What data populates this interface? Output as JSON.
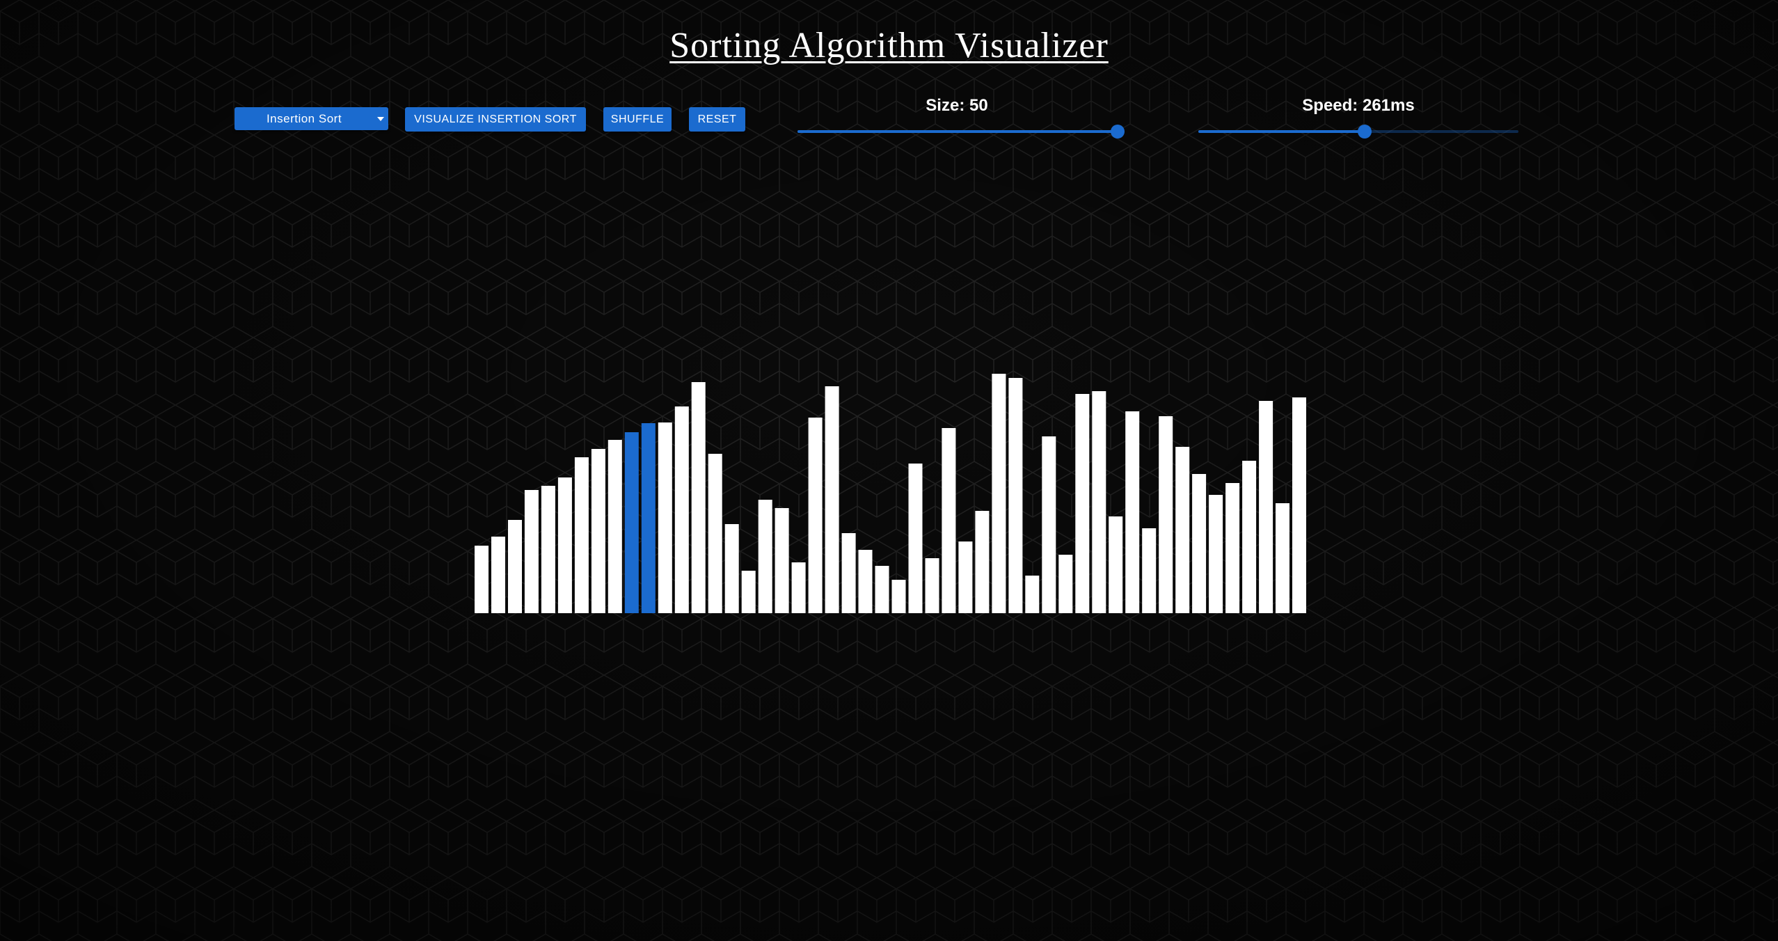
{
  "app": {
    "title": "Sorting Algorithm Visualizer"
  },
  "controls": {
    "algorithm_select": {
      "selected": "Insertion Sort"
    },
    "visualize_label": "VISUALIZE INSERTION SORT",
    "shuffle_label": "SHUFFLE",
    "reset_label": "RESET",
    "size_slider": {
      "label": "Size: 50",
      "value": 50,
      "fraction": 1.0
    },
    "speed_slider": {
      "label": "Speed: 261ms",
      "value_ms": 261,
      "fraction": 0.52
    }
  },
  "colors": {
    "accent": "#1b6bcf",
    "bar": "#ffffff",
    "active_bar": "#1b6bcf",
    "background": "#0a0a0a"
  },
  "array": {
    "values": [
      97,
      110,
      134,
      177,
      183,
      195,
      224,
      236,
      249,
      260,
      273,
      274,
      297,
      332,
      229,
      128,
      61,
      163,
      151,
      73,
      281,
      326,
      115,
      91,
      68,
      48,
      215,
      79,
      266,
      103,
      147,
      344,
      338,
      54,
      254,
      84,
      315,
      319,
      139,
      290,
      122,
      283,
      239,
      200,
      170,
      187,
      219,
      305,
      158,
      310
    ],
    "active_indices": [
      9,
      10
    ]
  }
}
